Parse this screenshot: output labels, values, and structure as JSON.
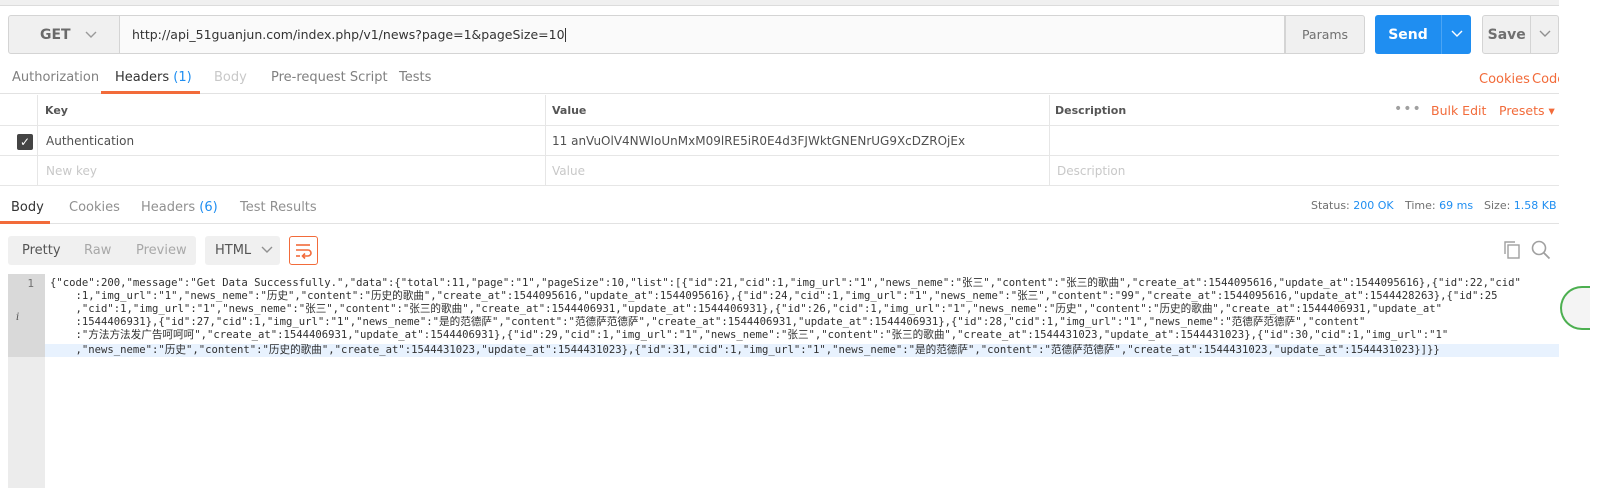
{
  "request": {
    "method": "GET",
    "url": "http://api_51guanjun.com/index.php/v1/news?page=1&pageSize=10",
    "params_label": "Params",
    "send_label": "Send",
    "save_label": "Save"
  },
  "request_tabs": {
    "authorization": "Authorization",
    "headers": "Headers",
    "headers_count": "(1)",
    "body": "Body",
    "prerequest": "Pre-request Script",
    "tests": "Tests",
    "cookies": "Cookies",
    "code": "Code"
  },
  "headers_table": {
    "col_key": "Key",
    "col_value": "Value",
    "col_description": "Description",
    "bulk_edit": "Bulk Edit",
    "presets": "Presets ▾",
    "row_key": "Authentication",
    "row_value": "11 anVuOlV4NWIoUnMxM09lRE5iR0E4d3FJWktGNENrUG9XcDZROjEx",
    "new_key_placeholder": "New key",
    "value_placeholder": "Value",
    "description_placeholder": "Description"
  },
  "response_tabs": {
    "body": "Body",
    "cookies": "Cookies",
    "headers": "Headers",
    "headers_count": "(6)",
    "test_results": "Test Results",
    "status_label": "Status:",
    "status_value": "200 OK",
    "time_label": "Time:",
    "time_value": "69 ms",
    "size_label": "Size:",
    "size_value": "1.58 KB"
  },
  "response_toolbar": {
    "pretty": "Pretty",
    "raw": "Raw",
    "preview": "Preview",
    "format": "HTML"
  },
  "code": {
    "line_number": "1",
    "info_marker": "i",
    "lines": [
      "{\"code\":200,\"message\":\"Get Data Successfully.\",\"data\":{\"total\":11,\"page\":\"1\",\"pageSize\":10,\"list\":[{\"id\":21,\"cid\":1,\"img_url\":\"1\",\"news_neme\":\"张三\",\"content\":\"张三的歌曲\",\"create_at\":1544095616,\"update_at\":1544095616},{\"id\":22,\"cid\"",
      "    :1,\"img_url\":\"1\",\"news_neme\":\"历史\",\"content\":\"历史的歌曲\",\"create_at\":1544095616,\"update_at\":1544095616},{\"id\":24,\"cid\":1,\"img_url\":\"1\",\"news_neme\":\"张三\",\"content\":\"99\",\"create_at\":1544095616,\"update_at\":1544428263},{\"id\":25",
      "    ,\"cid\":1,\"img_url\":\"1\",\"news_neme\":\"张三\",\"content\":\"张三的歌曲\",\"create_at\":1544406931,\"update_at\":1544406931},{\"id\":26,\"cid\":1,\"img_url\":\"1\",\"news_neme\":\"历史\",\"content\":\"历史的歌曲\",\"create_at\":1544406931,\"update_at\"",
      "    :1544406931},{\"id\":27,\"cid\":1,\"img_url\":\"1\",\"news_neme\":\"是的范德萨\",\"content\":\"范德萨范德萨\",\"create_at\":1544406931,\"update_at\":1544406931},{\"id\":28,\"cid\":1,\"img_url\":\"1\",\"news_neme\":\"范德萨范德萨\",\"content\"",
      "    :\"方法方法发广告呵呵呵\",\"create_at\":1544406931,\"update_at\":1544406931},{\"id\":29,\"cid\":1,\"img_url\":\"1\",\"news_neme\":\"张三\",\"content\":\"张三的歌曲\",\"create_at\":1544431023,\"update_at\":1544431023},{\"id\":30,\"cid\":1,\"img_url\":\"1\"",
      "    ,\"news_neme\":\"历史\",\"content\":\"历史的歌曲\",\"create_at\":1544431023,\"update_at\":1544431023},{\"id\":31,\"cid\":1,\"img_url\":\"1\",\"news_neme\":\"是的范德萨\",\"content\":\"范德萨范德萨\",\"create_at\":1544431023,\"update_at\":1544431023}]}}"
    ]
  },
  "colors": {
    "accent_orange": "#f26b3a",
    "send_blue": "#1f8ef1",
    "status_blue": "#1f8ef1"
  },
  "icons": {
    "method_dropdown": "chevron-down-icon",
    "send_dropdown": "chevron-down-icon",
    "save_dropdown": "chevron-down-icon",
    "checkbox": "checkmark-icon",
    "more": "ellipsis-icon",
    "wrap": "wrap-lines-icon",
    "copy": "copy-icon",
    "search": "search-icon"
  }
}
